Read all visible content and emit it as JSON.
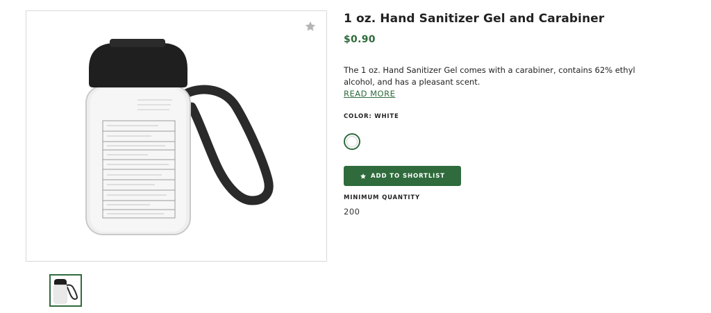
{
  "product": {
    "title": "1 oz. Hand Sanitizer Gel and Carabiner",
    "price": "$0.90",
    "description": "The 1 oz. Hand Sanitizer Gel comes with a carabiner, contains 62% ethyl alcohol, and has a pleasant scent.",
    "read_more_label": "READ MORE",
    "color_label": "COLOR: WHITE",
    "selected_color": "#ffffff",
    "add_button_label": "ADD TO SHORTLIST",
    "add_button_icon": "star-icon",
    "min_quantity_label": "MINIMUM QUANTITY",
    "min_quantity_value": "200"
  },
  "gallery": {
    "favorite_icon": "star-icon",
    "image_subject": "hand-sanitizer-bottle-with-carabiner",
    "thumbnail_count": 1
  },
  "colors": {
    "accent": "#2f6b3c",
    "text": "#222222",
    "border": "#d8d8d8"
  }
}
